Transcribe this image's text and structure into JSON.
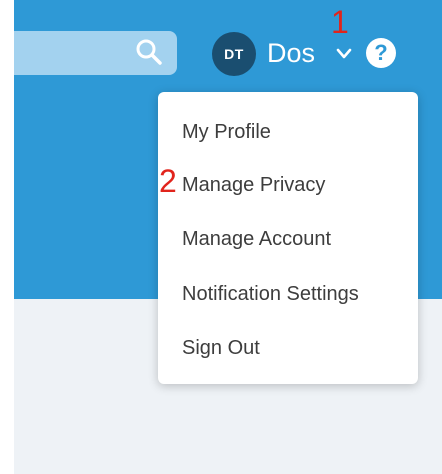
{
  "header": {
    "search": {
      "icon": "search-icon"
    },
    "user": {
      "initials": "DT",
      "name": "Dos"
    },
    "help_label": "?",
    "colors": {
      "bar": "#2e99d6",
      "avatar": "#1a4e70"
    }
  },
  "annotations": {
    "one": "1",
    "two": "2"
  },
  "menu": {
    "items": [
      {
        "label": "My Profile"
      },
      {
        "label": "Manage Privacy"
      },
      {
        "label": "Manage Account"
      },
      {
        "label": "Notification Settings"
      },
      {
        "label": "Sign Out"
      }
    ]
  }
}
